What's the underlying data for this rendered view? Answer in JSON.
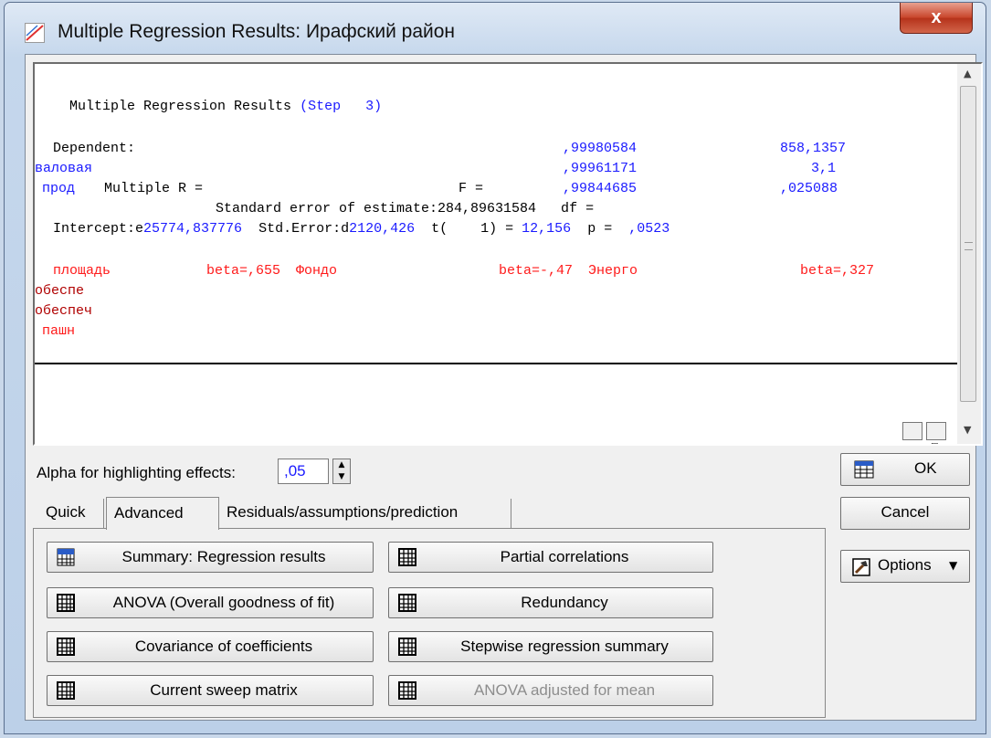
{
  "window": {
    "title": "Multiple Regression Results: Ирафский район",
    "close_label": "x"
  },
  "results": {
    "header": "Multiple Regression Results",
    "step_label": "(Step   3)",
    "line_dependent": "Dependent:",
    "val_r": ",99980584",
    "val_f": "858,1357",
    "line_valovaya": "валовая",
    "val_r2": ",99961171",
    "val_df": "3,1",
    "line_prod": "прод",
    "multiple_r_label": "Multiple R =",
    "f_label": "F =",
    "val_adj": ",99844685",
    "val_p": ",025088",
    "std_error_line": "Standard error of estimate:284,89631584   df =",
    "intercept_label": "Intercept:e",
    "intercept_val": "25774,837776",
    "stderr_label": "Std.Error:d",
    "stderr_val": "2120,426",
    "t_label": "t(    1) =",
    "t_val": "12,156",
    "p_label": "p =",
    "p_val": ",0523",
    "beta_var1": "площадь",
    "beta_val1": "beta=,655",
    "beta_var2": "Фондо",
    "beta_val2": "beta=-,47",
    "beta_var3": "Энерго",
    "beta_val3": "beta=,327",
    "cont1": "обеспе",
    "cont2": "обеспеч",
    "cont3": "пашн"
  },
  "alpha": {
    "label": "Alpha for highlighting effects:",
    "value": ",05"
  },
  "tabs": [
    {
      "label": "Quick"
    },
    {
      "label": "Advanced"
    },
    {
      "label": "Residuals/assumptions/prediction"
    }
  ],
  "buttons": {
    "summary": "Summary:  Regression results",
    "partial": "Partial correlations",
    "anova": "ANOVA (Overall goodness of fit)",
    "redundancy": "Redundancy",
    "covariance": "Covariance of coefficients",
    "stepwise": "Stepwise regression summary",
    "sweep": "Current sweep matrix",
    "anova_adj": "ANOVA adjusted for mean"
  },
  "side": {
    "ok": "OK",
    "cancel": "Cancel",
    "options": "Options"
  },
  "colors": {
    "text_blue": "#1a1aff",
    "text_red": "#ff1a1a",
    "text_darkred": "#b00000"
  },
  "icons": [
    "regression-app-icon",
    "grid-table-icon",
    "summary-table-icon",
    "copy-icon",
    "scroll-up-icon",
    "options-hammer-icon",
    "ok-table-icon"
  ]
}
